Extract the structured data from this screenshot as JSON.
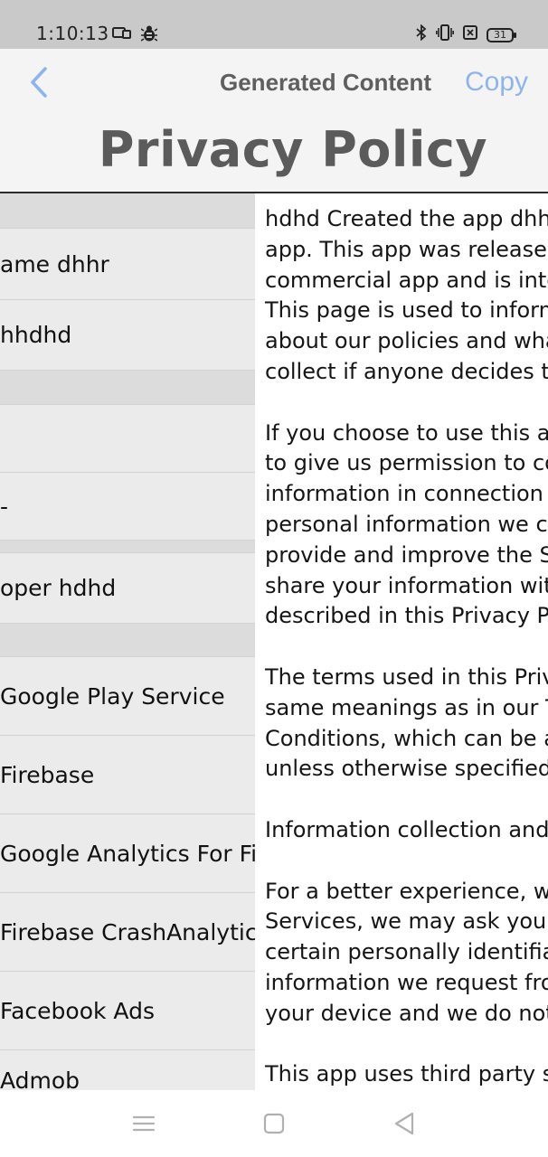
{
  "status_bar": {
    "time": "1:10:13",
    "battery": "31",
    "left_icons": [
      "cast-icon",
      "bug-icon"
    ],
    "right_icons": [
      "bluetooth-icon",
      "vibrate-icon",
      "data-icon",
      "battery-icon"
    ]
  },
  "header": {
    "title": "Generated Content",
    "copy_label": "Copy",
    "page_title": "Privacy Policy"
  },
  "fields": [
    {
      "label": "",
      "type": "section"
    },
    {
      "label": "ame  dhhr",
      "type": "row"
    },
    {
      "label": " hhdhd",
      "type": "row"
    },
    {
      "label": "",
      "type": "section"
    },
    {
      "label": "",
      "type": "row"
    },
    {
      "label": "-",
      "type": "row"
    },
    {
      "label": "",
      "type": "section"
    },
    {
      "label": "oper  hdhd",
      "type": "row"
    },
    {
      "label": "",
      "type": "section"
    },
    {
      "label": "Google Play Service",
      "type": "row"
    },
    {
      "label": "Firebase",
      "type": "row"
    },
    {
      "label": "Google Analytics For Firebase",
      "type": "row"
    },
    {
      "label": "Firebase CrashAnalytics",
      "type": "row"
    },
    {
      "label": "Facebook Ads",
      "type": "row"
    },
    {
      "label": "Admob",
      "type": "row"
    }
  ],
  "policy_paragraphs": [
    [
      "hdhd Created the app dhhr",
      "app. This app was released",
      "commercial app and is intended",
      "This page is used to inform",
      "about our policies and what",
      "collect if anyone decides to"
    ],
    [
      "If you choose to use this app",
      "to give us permission to collect",
      "information in connection",
      "personal information we collect",
      "provide and improve the Service",
      "share your information with",
      "described in this Privacy Policy"
    ],
    [
      "The terms used in this Privacy",
      "same meanings as in our Terms",
      "Conditions, which can be accessed",
      "unless otherwise specified"
    ],
    [
      "Information collection and use"
    ],
    [
      "For a better experience, while",
      "Services, we may ask you to",
      "certain personally identifiable",
      "information we request from",
      "your device and we do not"
    ],
    [
      "This app uses third party services"
    ]
  ],
  "colors": {
    "status_bar_bg": "#c9c9c9",
    "header_bg": "#f4f4f5",
    "accent_blue": "#8db4ec",
    "title_gray": "#5b5b5b"
  }
}
